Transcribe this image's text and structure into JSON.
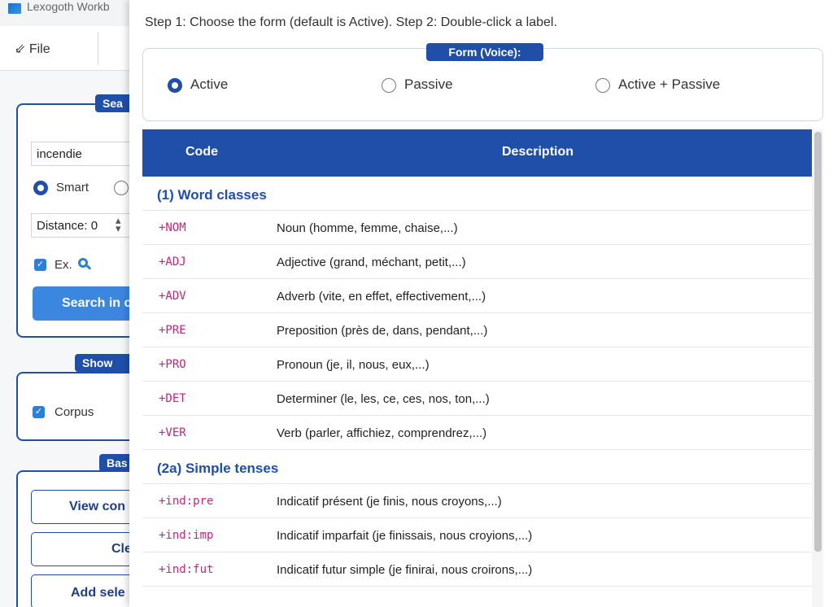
{
  "app": {
    "title": "Lexogoth Workb"
  },
  "menu": {
    "file_label": "⇙ File"
  },
  "sidebar": {
    "search_group_tag": "Sea",
    "search_input_value": "incendie",
    "mode_smart_label": "Smart",
    "distance_label": "Distance: 0",
    "ex_label": "Ex.",
    "search_button_label": "Search in c",
    "show_group_tag": "Show",
    "corpus_label": "Corpus",
    "basket_group_tag": "Bas",
    "view_button_label": "View con",
    "clear_button_label": "Cle",
    "add_button_label": "Add sele"
  },
  "dialog": {
    "instructions": "Step 1: Choose the form (default is Active). Step 2: Double-click a label.",
    "form_group_title": "Form (Voice):",
    "voice_options": [
      {
        "label": "Active",
        "selected": true
      },
      {
        "label": "Passive",
        "selected": false
      },
      {
        "label": "Active + Passive",
        "selected": false
      }
    ],
    "table": {
      "columns": [
        "Code",
        "Description"
      ],
      "sections": [
        {
          "title": "(1) Word classes",
          "rows": [
            {
              "code": "+NOM",
              "description": "Noun (homme, femme, chaise,...)"
            },
            {
              "code": "+ADJ",
              "description": "Adjective (grand, méchant, petit,...)"
            },
            {
              "code": "+ADV",
              "description": "Adverb (vite, en effet, effectivement,...)"
            },
            {
              "code": "+PRE",
              "description": "Preposition (près de, dans, pendant,...)"
            },
            {
              "code": "+PRO",
              "description": "Pronoun (je, il, nous, eux,...)"
            },
            {
              "code": "+DET",
              "description": "Determiner (le, les, ce, ces, nos, ton,...)"
            },
            {
              "code": "+VER",
              "description": "Verb (parler, affichiez, comprendrez,...)"
            }
          ]
        },
        {
          "title": "(2a) Simple tenses",
          "rows": [
            {
              "code": "+ind:pre",
              "description": "Indicatif présent (je finis, nous croyons,...)"
            },
            {
              "code": "+ind:imp",
              "description": "Indicatif imparfait (je finissais, nous croyions,...)"
            },
            {
              "code": "+ind:fut",
              "description": "Indicatif futur simple (je finirai, nous croirons,...)"
            }
          ]
        }
      ]
    }
  },
  "colors": {
    "accent": "#1f4fa8",
    "code_text": "#c0267e",
    "button_blue": "#3b87e0"
  },
  "icons": {
    "app_logo": "app-logo-icon",
    "search": "magnifier-icon",
    "check": "checkmark-icon"
  }
}
